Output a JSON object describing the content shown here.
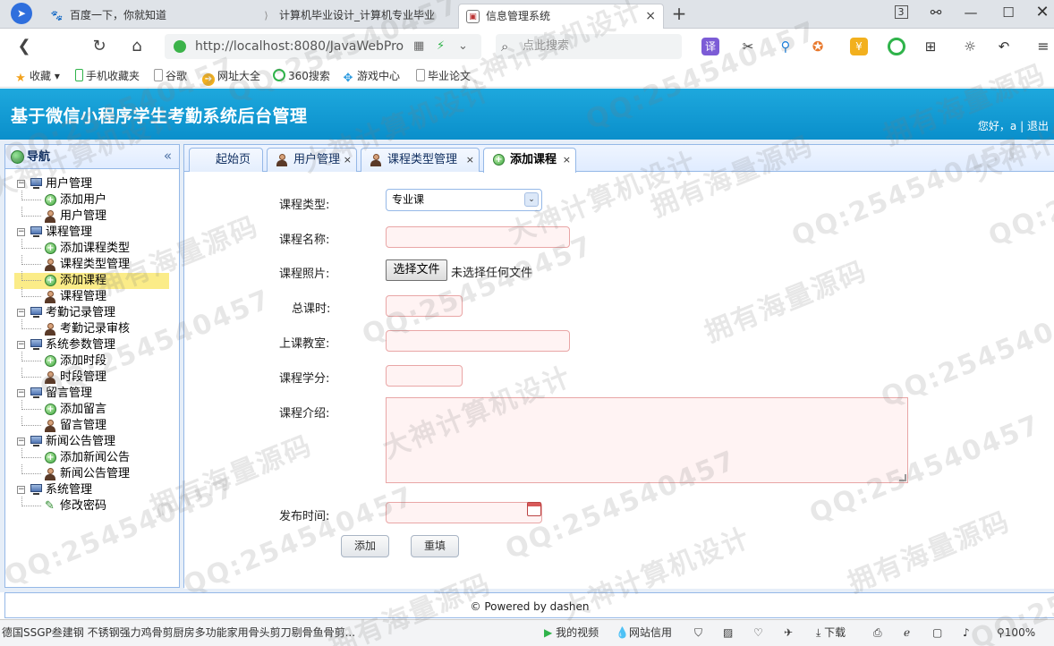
{
  "browser": {
    "tabs": [
      {
        "label": "百度一下，你就知道",
        "icon": "baidu-icon"
      },
      {
        "label": "计算机毕业设计_计算机专业毕业",
        "icon": "page-icon"
      },
      {
        "label": "信息管理系统",
        "icon": "image-icon",
        "active": true
      }
    ],
    "window_controls": {
      "badge": "3"
    },
    "url": "http://localhost:8080/JavaWebPro",
    "search_placeholder": "点此搜索",
    "bookmarks": [
      {
        "label": "收藏",
        "icon": "star-icon"
      },
      {
        "label": "手机收藏夹",
        "icon": "phone-icon"
      },
      {
        "label": "谷歌",
        "icon": "doc-icon"
      },
      {
        "label": "网址大全",
        "icon": "navigation-icon"
      },
      {
        "label": "360搜索",
        "icon": "search-360-icon"
      },
      {
        "label": "游戏中心",
        "icon": "game-icon"
      },
      {
        "label": "毕业论文",
        "icon": "doc-icon"
      }
    ]
  },
  "app": {
    "title": "基于微信小程序学生考勤系统后台管理",
    "greeting": "您好，a",
    "separator": "|",
    "logout": "退出",
    "nav": {
      "title": "导航",
      "groups": [
        {
          "label": "用户管理",
          "items": [
            {
              "label": "添加用户",
              "icon": "add-icon"
            },
            {
              "label": "用户管理",
              "icon": "user-icon"
            }
          ]
        },
        {
          "label": "课程管理",
          "items": [
            {
              "label": "添加课程类型",
              "icon": "add-icon"
            },
            {
              "label": "课程类型管理",
              "icon": "user-icon"
            },
            {
              "label": "添加课程",
              "icon": "add-icon",
              "selected": true
            },
            {
              "label": "课程管理",
              "icon": "user-icon"
            }
          ]
        },
        {
          "label": "考勤记录管理",
          "items": [
            {
              "label": "考勤记录审核",
              "icon": "user-icon"
            }
          ]
        },
        {
          "label": "系统参数管理",
          "items": [
            {
              "label": "添加时段",
              "icon": "add-icon"
            },
            {
              "label": "时段管理",
              "icon": "user-icon"
            }
          ]
        },
        {
          "label": "留言管理",
          "items": [
            {
              "label": "添加留言",
              "icon": "add-icon"
            },
            {
              "label": "留言管理",
              "icon": "user-icon"
            }
          ]
        },
        {
          "label": "新闻公告管理",
          "items": [
            {
              "label": "添加新闻公告",
              "icon": "add-icon"
            },
            {
              "label": "新闻公告管理",
              "icon": "user-icon"
            }
          ]
        },
        {
          "label": "系统管理",
          "items": [
            {
              "label": "修改密码",
              "icon": "pencil-icon"
            }
          ]
        }
      ]
    },
    "tabs": [
      {
        "label": "起始页",
        "closable": false
      },
      {
        "label": "用户管理",
        "closable": true,
        "icon": "user-icon"
      },
      {
        "label": "课程类型管理",
        "closable": true,
        "icon": "user-icon"
      },
      {
        "label": "添加课程",
        "closable": true,
        "icon": "add-icon",
        "selected": true
      }
    ],
    "form": {
      "course_type_label": "课程类型:",
      "course_type_value": "专业课",
      "course_name_label": "课程名称:",
      "course_photo_label": "课程照片:",
      "choose_file": "选择文件",
      "no_file": "未选择任何文件",
      "total_hours_label": "总课时:",
      "classroom_label": "上课教室:",
      "credits_label": "课程学分:",
      "intro_label": "课程介绍:",
      "publish_time_label": "发布时间:",
      "add_button": "添加",
      "reset_button": "重填"
    },
    "footer": "© Powered by dashen"
  },
  "statusbar": {
    "ad_text": "德国SSGP叁建钢 不锈钢强力鸡骨剪厨房多功能家用骨头剪刀剔骨鱼骨剪...",
    "items": [
      "我的视频",
      "网站信用",
      "下载"
    ],
    "zoom": "100%"
  },
  "watermarks": [
    "QQ:254540457",
    "大神计算机设计",
    "拥有海量源码"
  ],
  "colors": {
    "header": "#0a8fcb",
    "accent": "#95b8e7",
    "invalid_field": "#fff3f3",
    "selected_node": "#fbec88"
  }
}
